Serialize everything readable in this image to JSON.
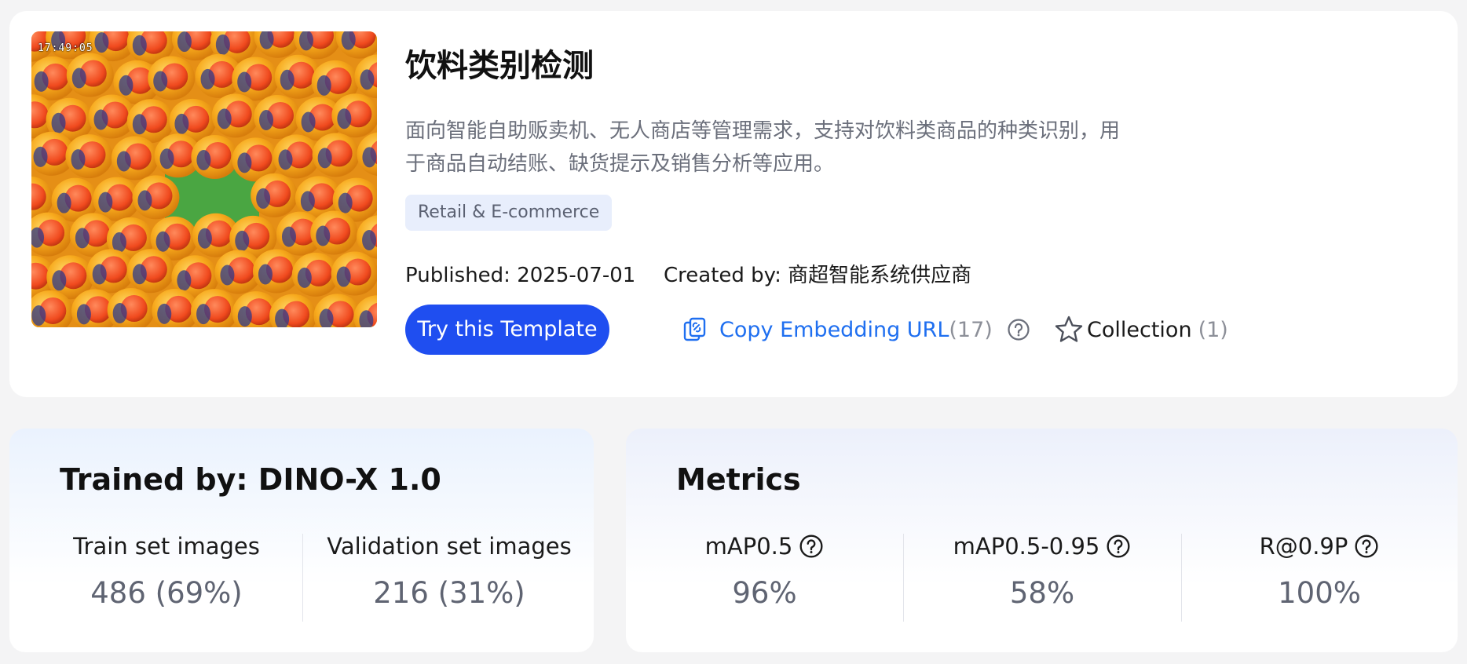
{
  "template": {
    "thumbnail_timestamp": "17:49:05",
    "title": "饮料类别检测",
    "description": "面向智能自助贩卖机、无人商店等管理需求，支持对饮料类商品的种类识别，用于商品自动结账、缺货提示及销售分析等应用。",
    "tag": "Retail & E-commerce",
    "published": "Published: 2025-07-01",
    "created_by": "Created by: 商超智能系统供应商",
    "try_button": "Try this Template",
    "copy_embed_label": "Copy Embedding URL",
    "copy_embed_count": "(17)",
    "collection_label": "Collection",
    "collection_count": "(1)"
  },
  "training": {
    "heading": "Trained by: DINO-X 1.0",
    "train_label": "Train set images",
    "train_value": "486 (69%)",
    "val_label": "Validation set images",
    "val_value": "216 (31%)"
  },
  "metrics": {
    "heading": "Metrics",
    "items": [
      {
        "label": "mAP0.5",
        "value": "96%"
      },
      {
        "label": "mAP0.5-0.95",
        "value": "58%"
      },
      {
        "label": "R@0.9P",
        "value": "100%"
      }
    ]
  },
  "colors": {
    "primary": "#1f4ef0",
    "link": "#1f6ff0",
    "tag_bg": "#e8eefc",
    "muted": "#8c8f98"
  },
  "icons": [
    "link-copy-icon",
    "help-circle-icon",
    "star-outline-icon"
  ]
}
